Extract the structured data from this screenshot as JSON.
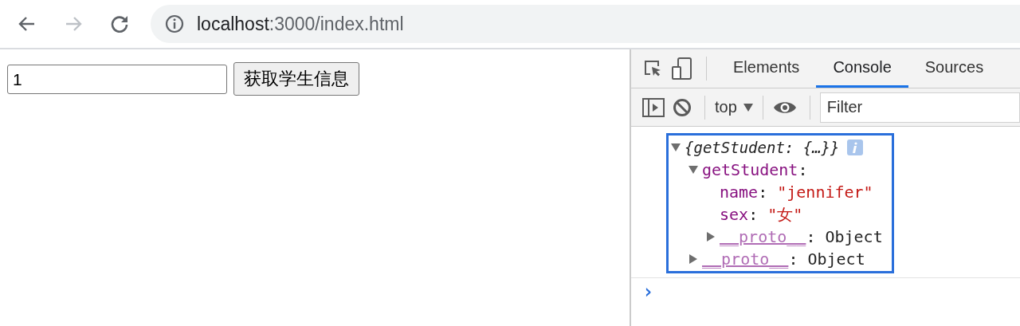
{
  "browser": {
    "nav": [
      {
        "kind": "back",
        "disabled": false
      },
      {
        "kind": "forward",
        "disabled": true
      },
      {
        "kind": "reload",
        "disabled": false
      }
    ],
    "url_host": "localhost",
    "url_rest": ":3000/index.html"
  },
  "page": {
    "input_value": "1",
    "button": "获取学生信息"
  },
  "devtools": {
    "tabs": [
      {
        "label": "Elements",
        "selected": false
      },
      {
        "label": "Console",
        "selected": true
      },
      {
        "label": "Sources",
        "selected": false
      }
    ],
    "context": "top",
    "filter_placeholder": "Filter",
    "console_tree": [
      {
        "kind": "summary",
        "text": "{getStudent: {…}}",
        "expanded": true,
        "children": [
          {
            "kind": "key",
            "key": "getStudent",
            "sep": ":",
            "expanded": true,
            "children": [
              {
                "kind": "prop",
                "key": "name",
                "sep": ":",
                "value": "\"jennifer\""
              },
              {
                "kind": "prop",
                "key": "sex",
                "sep": ":",
                "value": "\"女\""
              },
              {
                "kind": "proto",
                "key": "__proto__",
                "sep": ":",
                "value": "Object",
                "expanded": false
              }
            ]
          },
          {
            "kind": "proto",
            "key": "__proto__",
            "sep": ":",
            "value": "Object",
            "expanded": false
          }
        ]
      }
    ],
    "prompt": "›"
  }
}
